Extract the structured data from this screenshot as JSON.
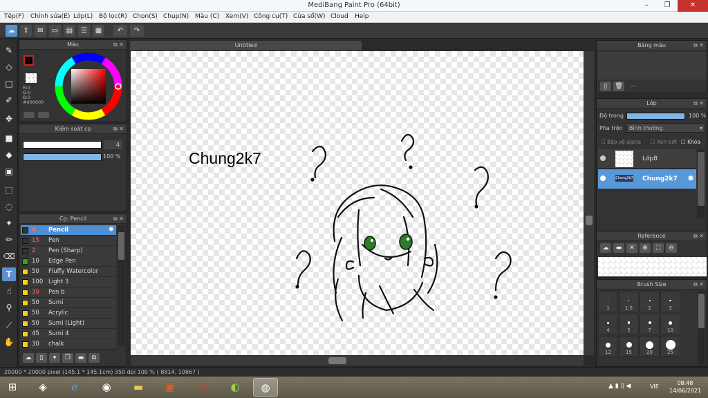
{
  "window": {
    "title": "MediBang Paint Pro (64bit)",
    "minimize": "–",
    "maximize": "❐",
    "close": "✕"
  },
  "menu": [
    "Tệp(F)",
    "Chỉnh sửa(E)",
    "Lớp(L)",
    "Bộ lọc(R)",
    "Chọn(S)",
    "Chụp(N)",
    "Màu (C)",
    "Xem(V)",
    "Công cụ(T)",
    "Cửa sổ(W)",
    "Cloud",
    "Help"
  ],
  "toolbar": {
    "undo": "↶",
    "redo": "↷"
  },
  "color_panel": {
    "title": "Màu",
    "r": "R:0",
    "g": "G:0",
    "b": "B:0",
    "hex": "#000000",
    "fg_color": "#000000"
  },
  "brush_control": {
    "title": "Kiểm soát cọ",
    "size": "4",
    "opacity": "100 %"
  },
  "brush_panel": {
    "title": "Cọ: Pencil",
    "brushes": [
      {
        "size": "4",
        "name": "Pencil",
        "color": "#333333",
        "numcolor": "#ff6b6b"
      },
      {
        "size": "15",
        "name": "Pen",
        "color": "#333333",
        "numcolor": "#ff6b6b"
      },
      {
        "size": "2",
        "name": "Pen (Sharp)",
        "color": "#333333",
        "numcolor": "#ff6b6b"
      },
      {
        "size": "10",
        "name": "Edge Pen",
        "color": "#22aa22",
        "numcolor": "#dddddd"
      },
      {
        "size": "50",
        "name": "Fluffy Watercolor",
        "color": "#f2d21a",
        "numcolor": "#dddddd"
      },
      {
        "size": "100",
        "name": "Light 3",
        "color": "#f2d21a",
        "numcolor": "#dddddd"
      },
      {
        "size": "30",
        "name": " Pen b",
        "color": "#f2d21a",
        "numcolor": "#ff6b6b"
      },
      {
        "size": "50",
        "name": "Sumi",
        "color": "#f2d21a",
        "numcolor": "#dddddd"
      },
      {
        "size": "50",
        "name": "Acrylic",
        "color": "#f2d21a",
        "numcolor": "#dddddd"
      },
      {
        "size": "50",
        "name": "Sumi (Light)",
        "color": "#f2d21a",
        "numcolor": "#dddddd"
      },
      {
        "size": "45",
        "name": "Sumi 4",
        "color": "#f2d21a",
        "numcolor": "#dddddd"
      },
      {
        "size": "30",
        "name": "chalk",
        "color": "#f2d21a",
        "numcolor": "#dddddd"
      }
    ]
  },
  "canvas": {
    "tab": "Untitled",
    "text": "Chung2k7"
  },
  "palette_panel": {
    "title": "Bảng màu",
    "sep": "---"
  },
  "layer_panel": {
    "title": "Lớp",
    "opacity_label": "Độ trong",
    "opacity_value": "100 %",
    "blend_label": "Pha trộn",
    "blend_value": "Bình thường",
    "protect_alpha": "Bảo vệ alpha",
    "clip": "Xén bớt",
    "lock": "Khóa",
    "layers": [
      {
        "name": "Lớp8"
      },
      {
        "name": "Chung2k7"
      }
    ]
  },
  "reference_panel": {
    "title": "Reference"
  },
  "brush_size_panel": {
    "title": "Brush Size",
    "sizes": [
      "1",
      "1.5",
      "2",
      "3",
      "4",
      "5",
      "7",
      "10",
      "12",
      "15",
      "20",
      "25"
    ]
  },
  "status": {
    "text": "20000 * 20000 pixel   (145.1 * 145.1cm)   350 dpi   100 %   ( 8814, 10867 )"
  },
  "taskbar": {
    "lang": "VIE",
    "time": "08:48",
    "date": "14/06/2021"
  }
}
